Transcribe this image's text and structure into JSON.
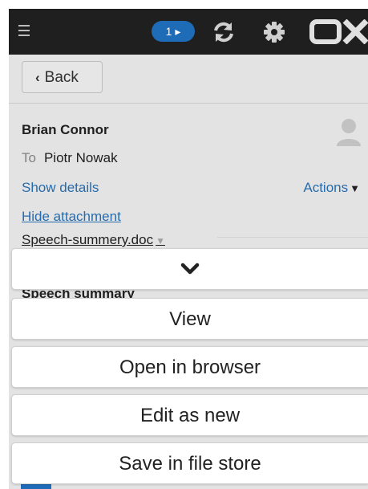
{
  "navbar": {
    "badge_count": "1",
    "badge_arrow": "▸",
    "logo": "OX",
    "icons": [
      "menu-icon",
      "refresh-icon",
      "gear-icon"
    ]
  },
  "toolbar": {
    "back_label": "Back",
    "back_icon": "‹"
  },
  "mail": {
    "sender": "Brian Connor",
    "to_label": "To",
    "recipient": "Piotr Nowak",
    "show_details": "Show details",
    "actions": "Actions",
    "hide_attachment": "Hide attachment",
    "attachment_name": "Speech-summery.doc",
    "body_title": "Speech summary"
  },
  "sheet": {
    "items": [
      "View",
      "Open in browser",
      "Edit as new",
      "Save in file store"
    ]
  },
  "colors": {
    "accent": "#2a72b8",
    "navbar": "#1f1f1f",
    "badge": "#1e6bb8"
  }
}
